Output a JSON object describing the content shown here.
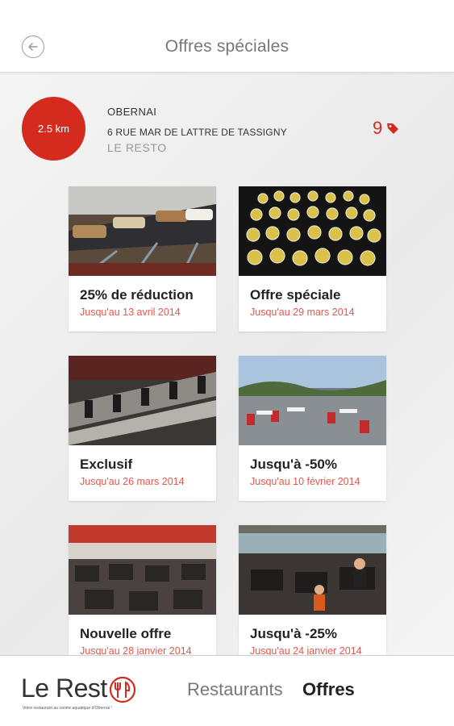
{
  "header": {
    "title": "Offres spéciales",
    "back_icon": "back-arrow-icon"
  },
  "restaurant": {
    "distance": "2.5 km",
    "city": "OBERNAI",
    "address": "6 RUE MAR DE LATTRE DE TASSIGNY",
    "name": "LE RESTO",
    "offer_count": "9",
    "count_icon": "tag-icon"
  },
  "offers": [
    {
      "title": "25% de réduction",
      "date": "Jusqu'au 13 avril 2014",
      "image": "buffet-table-photo"
    },
    {
      "title": "Offre spéciale",
      "date": "Jusqu'au 29 mars 2014",
      "image": "verrines-photo"
    },
    {
      "title": "Exclusif",
      "date": "Jusqu'au 26 mars 2014",
      "image": "dining-room-photo"
    },
    {
      "title": "Jusqu'à -50%",
      "date": "Jusqu'au 10 février 2014",
      "image": "terrace-photo"
    },
    {
      "title": "Nouvelle offre",
      "date": "Jusqu'au 28 janvier 2014",
      "image": "restaurant-interior-photo"
    },
    {
      "title": "Jusqu'à -25%",
      "date": "Jusqu'au 24 janvier 2014",
      "image": "diners-photo"
    }
  ],
  "bottom_nav": {
    "logo_text": "Le Rest",
    "logo_tagline": "Votre restaurant au centre aquatique d'Obernai !",
    "restaurants_label": "Restaurants",
    "offres_label": "Offres"
  },
  "colors": {
    "accent": "#d42b1f",
    "date_text": "#e0584d"
  }
}
